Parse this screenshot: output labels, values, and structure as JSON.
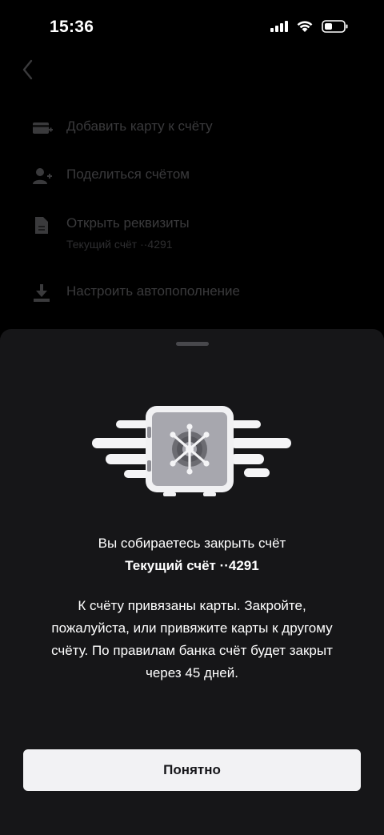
{
  "status_bar": {
    "time": "15:36",
    "icons": [
      "signal-icon",
      "wifi-icon",
      "battery-icon"
    ]
  },
  "background": {
    "back_icon": "chevron-left-icon",
    "menu": [
      {
        "icon": "add-card-icon",
        "label": "Добавить карту к счёту"
      },
      {
        "icon": "add-user-icon",
        "label": "Поделиться счётом"
      },
      {
        "icon": "document-icon",
        "label": "Открыть реквизиты",
        "sublabel": "Текущий счёт ··4291"
      },
      {
        "icon": "download-icon",
        "label": "Настроить автопополнение"
      }
    ]
  },
  "sheet": {
    "illustration": "safe-icon",
    "title": "Вы собираетесь закрыть счёт",
    "account": "Текущий счёт ··4291",
    "message": "К счёту привязаны карты. Закройте, пожалуйста, или привяжите карты к другому счёту. По правилам банка счёт будет закрыт через 45 дней.",
    "button_label": "Понятно"
  },
  "colors": {
    "sheet_background": "#161618",
    "button_background": "#f2f2f4",
    "dimmed_text": "#3a3a3c"
  }
}
